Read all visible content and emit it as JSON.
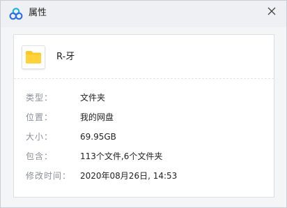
{
  "window": {
    "title": "属性"
  },
  "icons": {
    "app_logo": "baidu-netdisk-logo",
    "close": "close-icon",
    "folder": "folder-icon"
  },
  "colors": {
    "folder_yellow": "#ffc71f",
    "logo_blue": "#2f6ee6",
    "logo_cyan": "#18b4e6",
    "label_gray": "#8a8f98"
  },
  "file": {
    "name": "R-牙"
  },
  "properties": [
    {
      "label": "类型：",
      "value": "文件夹"
    },
    {
      "label": "位置：",
      "value": "我的网盘"
    },
    {
      "label": "大小：",
      "value": "69.95GB"
    },
    {
      "label": "包含：",
      "value": "113个文件,6个文件夹"
    },
    {
      "label": "修改时间：",
      "value": "2020年08月26日, 14:53"
    }
  ]
}
